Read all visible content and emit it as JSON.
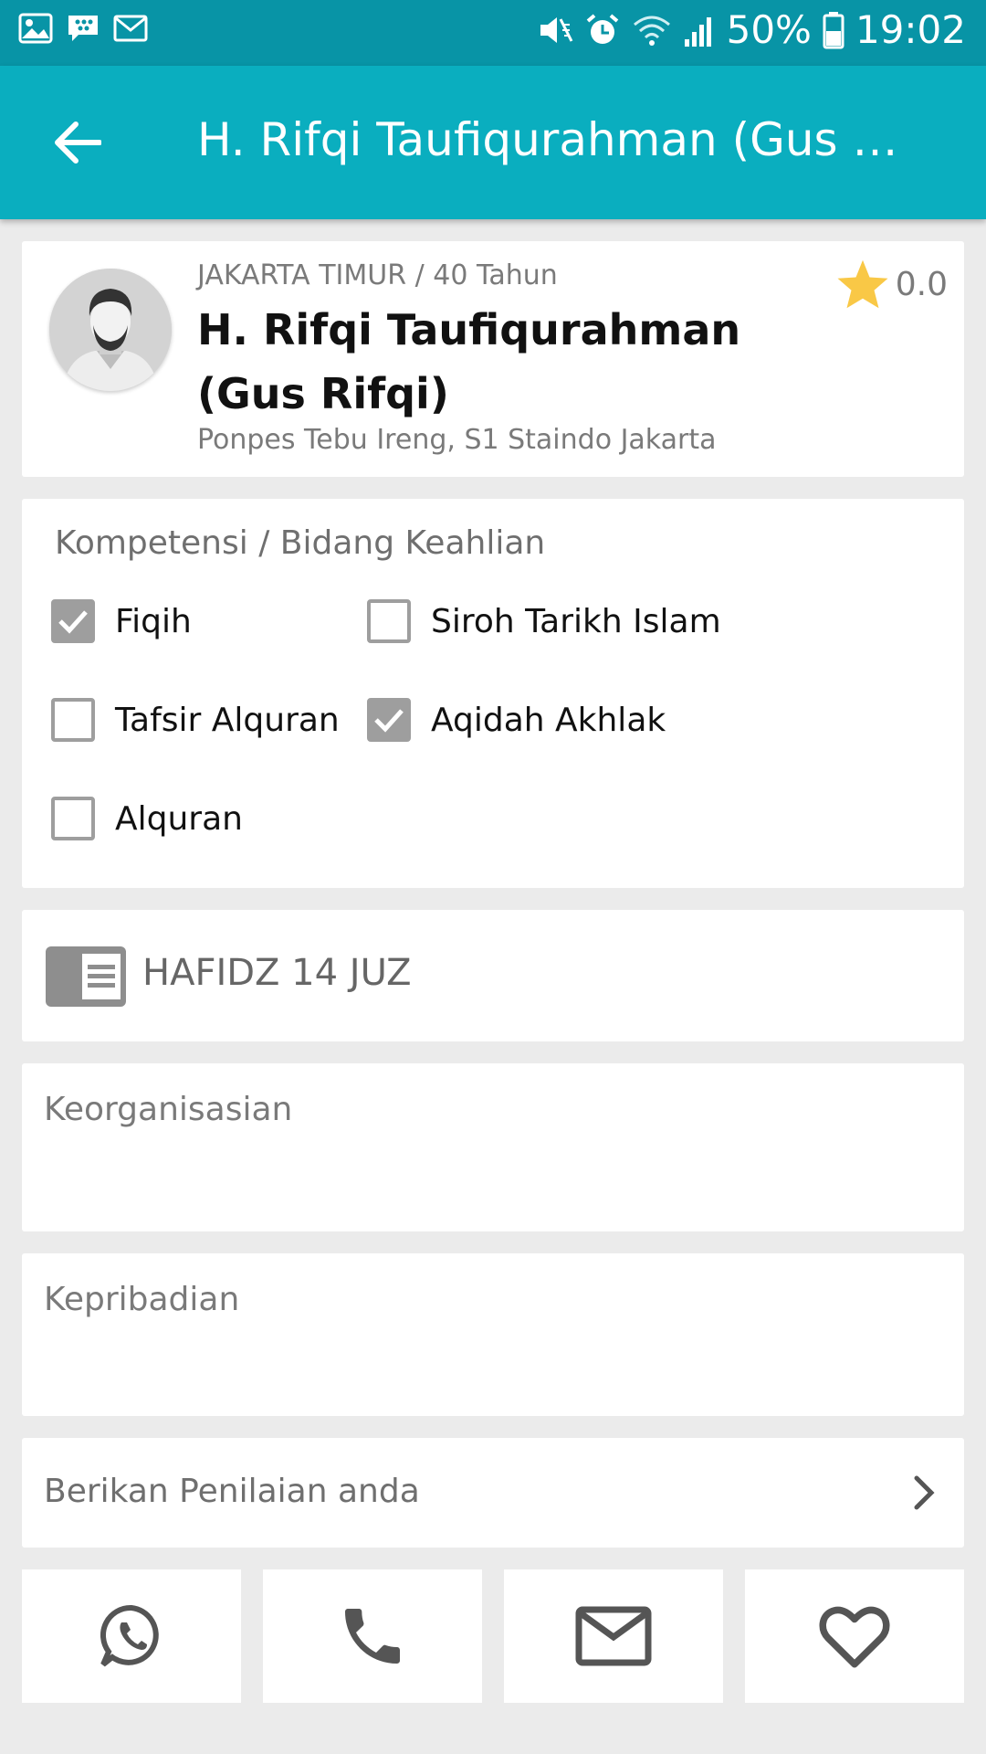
{
  "status_bar": {
    "battery": "50%",
    "time": "19:02",
    "left_icons": [
      "image-icon",
      "bbm-icon",
      "mail-icon"
    ],
    "right_icons": [
      "mute-icon",
      "alarm-icon",
      "wifi-icon",
      "signal-icon",
      "battery-icon"
    ]
  },
  "app_bar": {
    "title": "H. Rifqi Taufiqurahman (Gus R...",
    "back_icon": "arrow-left-icon",
    "color": "#0aaebf"
  },
  "profile": {
    "meta": "JAKARTA TIMUR / 40 Tahun",
    "name": "H. Rifqi Taufiqurahman (Gus Rifqi)",
    "education": "Ponpes Tebu Ireng, S1 Staindo Jakarta",
    "rating": "0.0"
  },
  "competence": {
    "title": "Kompetensi / Bidang Keahlian",
    "items": [
      {
        "label": "Fiqih",
        "checked": true
      },
      {
        "label": "Siroh Tarikh Islam",
        "checked": false
      },
      {
        "label": "Tafsir Alquran",
        "checked": false
      },
      {
        "label": "Aqidah Akhlak",
        "checked": true
      },
      {
        "label": "Alquran",
        "checked": false
      }
    ]
  },
  "hafidz": {
    "label": "HAFIDZ 14 JUZ"
  },
  "organization": {
    "label": "Keorganisasian"
  },
  "personality": {
    "label": "Kepribadian"
  },
  "rate_prompt": {
    "label": "Berikan Penilaian anda"
  },
  "actions": [
    "whatsapp-icon",
    "phone-icon",
    "email-icon",
    "heart-icon"
  ]
}
